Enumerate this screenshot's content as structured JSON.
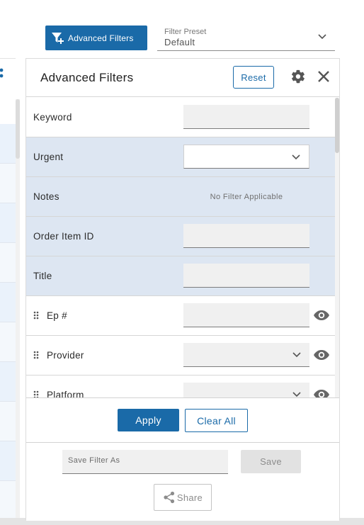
{
  "toolbar": {
    "advanced_filters_label": "Advanced Filters",
    "filter_icon": "filter-plus-icon"
  },
  "preset": {
    "label": "Filter Preset",
    "value": "Default",
    "chevron_icon": "chevron-down-icon"
  },
  "panel": {
    "title": "Advanced Filters",
    "reset_label": "Reset",
    "settings_icon": "gear-icon",
    "close_icon": "close-icon"
  },
  "filters": [
    {
      "label": "Keyword",
      "type": "text",
      "pinned": true,
      "value": ""
    },
    {
      "label": "Urgent",
      "type": "select",
      "pinned": true,
      "value": ""
    },
    {
      "label": "Notes",
      "type": "none",
      "pinned": true,
      "note": "No Filter Applicable"
    },
    {
      "label": "Order Item ID",
      "type": "text",
      "pinned": true,
      "value": ""
    },
    {
      "label": "Title",
      "type": "text",
      "pinned": true,
      "value": ""
    },
    {
      "label": "Ep #",
      "type": "text",
      "pinned": false,
      "value": "",
      "visible_icon": "eye-icon"
    },
    {
      "label": "Provider",
      "type": "select",
      "pinned": false,
      "value": "",
      "visible_icon": "eye-icon"
    },
    {
      "label": "Platform",
      "type": "select",
      "pinned": false,
      "value": "",
      "visible_icon": "eye-icon"
    }
  ],
  "actions": {
    "apply_label": "Apply",
    "clear_label": "Clear All"
  },
  "save": {
    "placeholder": "Save Filter As",
    "save_label": "Save",
    "share_label": "Share",
    "share_icon": "share-icon"
  },
  "colors": {
    "primary": "#1a6aa8",
    "pinned_row_bg": "#dde6f2"
  }
}
